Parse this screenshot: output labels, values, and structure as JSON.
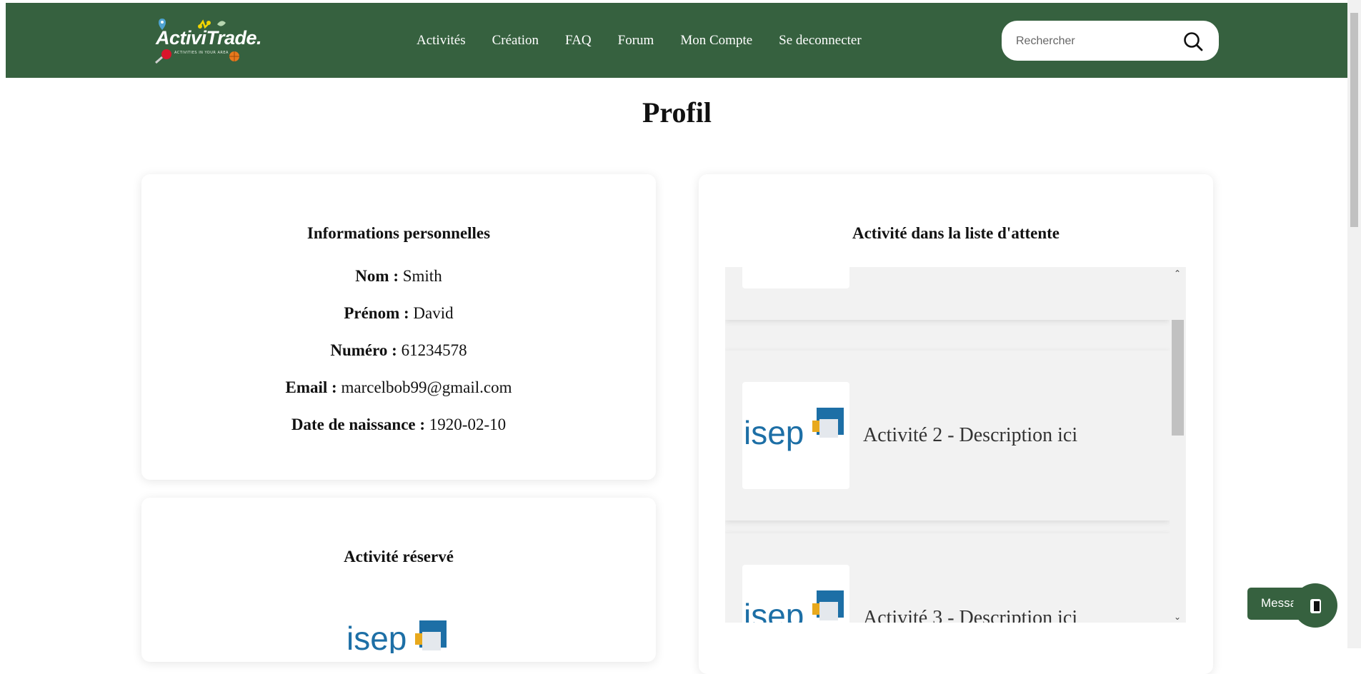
{
  "header": {
    "logo_text": "ActiviTrade.",
    "logo_tagline": "ACTIVITIES IN YOUR AREA",
    "nav": [
      "Activités",
      "Création",
      "FAQ",
      "Forum",
      "Mon Compte",
      "Se deconnecter"
    ],
    "search_placeholder": "Rechercher",
    "colors": {
      "brand_green": "#36613f"
    }
  },
  "page": {
    "title": "Profil"
  },
  "personal_info": {
    "title": "Informations personnelles",
    "rows": [
      {
        "label": "Nom :",
        "value": "Smith"
      },
      {
        "label": "Prénom :",
        "value": "David"
      },
      {
        "label": "Numéro :",
        "value": "61234578"
      },
      {
        "label": "Email :",
        "value": "marcelbob99@gmail.com"
      },
      {
        "label": "Date de naissance :",
        "value": "1920-02-10"
      }
    ]
  },
  "reserved": {
    "title": "Activité réservé"
  },
  "waiting_list": {
    "title": "Activité dans la liste d'attente",
    "items": [
      {
        "text": ""
      },
      {
        "text": "Activité 2 - Description ici"
      },
      {
        "text": "Activité 3 - Description ici"
      }
    ]
  },
  "message_widget": {
    "label": "Message"
  },
  "icons": [
    "search-icon",
    "chevron-up-icon",
    "chevron-down-icon",
    "chat-icon",
    "isep-logo-icon"
  ]
}
